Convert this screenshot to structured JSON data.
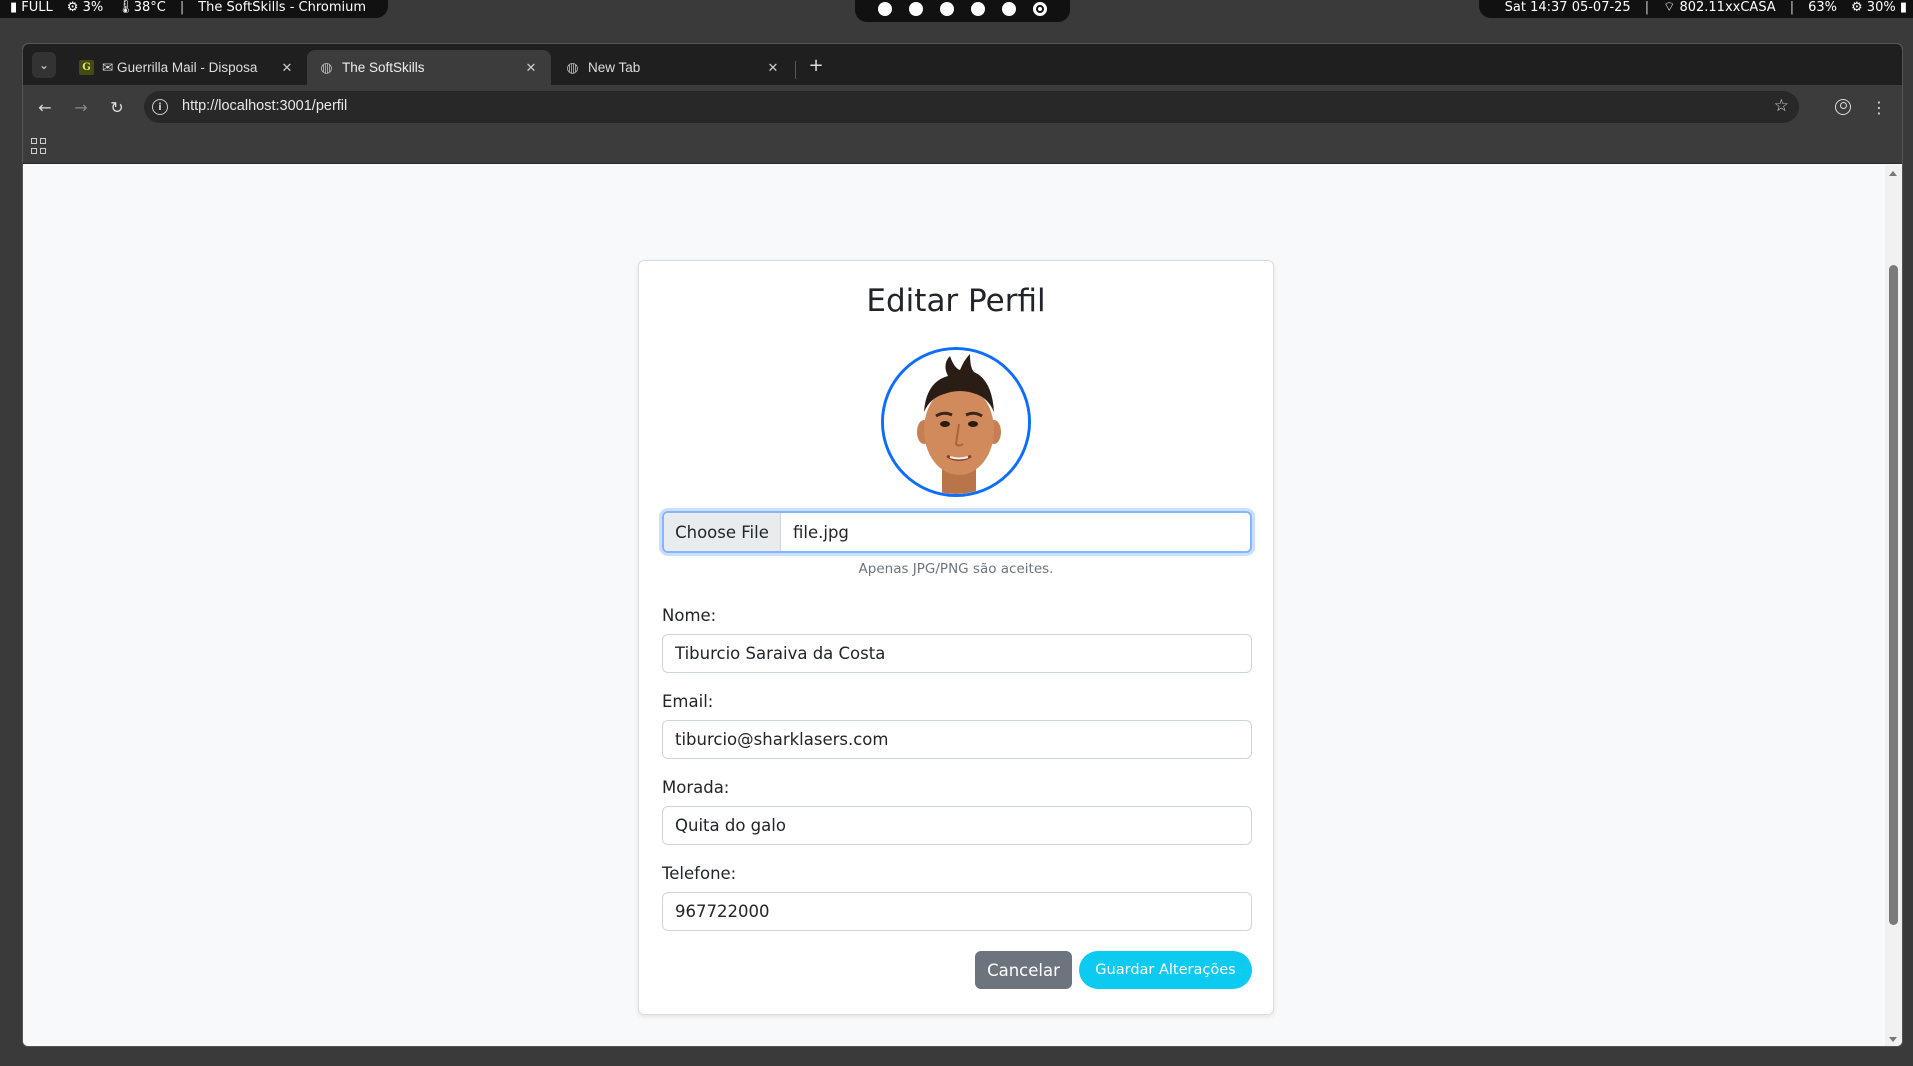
{
  "system_bar": {
    "battery_mode": "FULL",
    "cpu": "3%",
    "temp": "38°C",
    "window_title": "The SoftSkills - Chromium",
    "datetime": "Sat  14:37  05-07-25",
    "wifi": "802.11xxCASA",
    "volume": "63%",
    "brightness": "30%"
  },
  "browser": {
    "tabs": [
      {
        "label": "✉ Guerrilla Mail - Disposa",
        "favicon": "G"
      },
      {
        "label": "The SoftSkills",
        "favicon": "globe-icon"
      },
      {
        "label": "New Tab",
        "favicon": "globe-icon"
      }
    ],
    "active_tab": 1,
    "url": "http://localhost:3001/perfil"
  },
  "page": {
    "title": "Editar Perfil",
    "file_input": {
      "button_label": "Choose File",
      "file_name": "file.jpg",
      "hint": "Apenas JPG/PNG são aceites."
    },
    "fields": {
      "nome": {
        "label": "Nome:",
        "value": "Tiburcio Saraiva da Costa"
      },
      "email": {
        "label": "Email:",
        "value": "tiburcio@sharklasers.com"
      },
      "morada": {
        "label": "Morada:",
        "value": "Quita do galo"
      },
      "telefone": {
        "label": "Telefone:",
        "value": "967722000"
      }
    },
    "buttons": {
      "cancel": "Cancelar",
      "save": "Guardar Alterações"
    },
    "colors": {
      "primary": "#0d6efd",
      "info": "#0dcaf0",
      "secondary": "#6c757d"
    }
  }
}
